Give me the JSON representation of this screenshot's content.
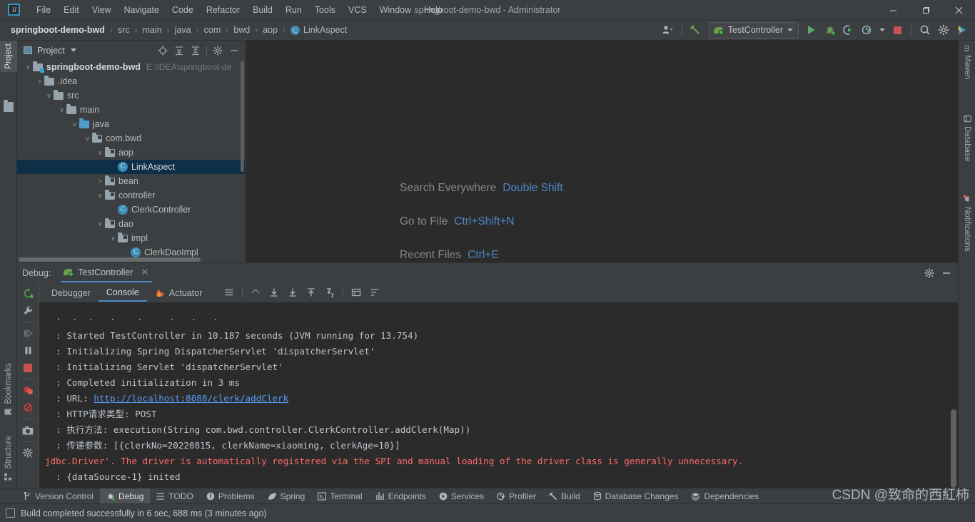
{
  "window": {
    "title": "springboot-demo-bwd - Administrator",
    "minimize": "–",
    "maximize": "❐",
    "close": "✕"
  },
  "menubar": {
    "items": [
      "File",
      "Edit",
      "View",
      "Navigate",
      "Code",
      "Refactor",
      "Build",
      "Run",
      "Tools",
      "VCS",
      "Window",
      "Help"
    ]
  },
  "breadcrumb": {
    "root": "springboot-demo-bwd",
    "separator": "›",
    "items": [
      "src",
      "main",
      "java",
      "com",
      "bwd",
      "aop"
    ],
    "leaf": "LinkAspect",
    "leaf_icon": "C"
  },
  "toolbar": {
    "user_icon": "user-icon",
    "build_icon": "hammer-icon",
    "run_config": "TestController",
    "run_label": "run-button",
    "debug_label": "debug-button",
    "coverage_label": "run-with-coverage-button",
    "profiler_label": "profiler-button",
    "stop_label": "stop-button",
    "search_label": "search-button",
    "settings_label": "settings-button"
  },
  "left_stripe": {
    "project": "Project",
    "bookmarks": "Bookmarks",
    "structure": "Structure"
  },
  "right_stripe": {
    "maven": "Maven",
    "database": "Database",
    "notifications": "Notifications"
  },
  "project_panel": {
    "title": "Project",
    "actions": [
      "locate-icon",
      "expand-all-icon",
      "collapse-all-icon",
      "gear-icon",
      "hide-icon"
    ],
    "tree": [
      {
        "indent": 0,
        "twisty": "v",
        "icon": "module-folder",
        "label": "springboot-demo-bwd",
        "bold": true,
        "path": "E:\\IDEA\\springboot-de",
        "selected": false
      },
      {
        "indent": 1,
        "twisty": ">",
        "icon": "folder",
        "label": ".idea",
        "bold": false,
        "path": "",
        "selected": false
      },
      {
        "indent": 1,
        "twisty": "v",
        "icon": "folder",
        "label": "src",
        "bold": false,
        "path": "",
        "selected": false
      },
      {
        "indent": 2,
        "twisty": "v",
        "icon": "folder",
        "label": "main",
        "bold": false,
        "path": "",
        "selected": false
      },
      {
        "indent": 3,
        "twisty": "v",
        "icon": "source-folder",
        "label": "java",
        "bold": false,
        "path": "",
        "selected": false
      },
      {
        "indent": 4,
        "twisty": "v",
        "icon": "package",
        "label": "com.bwd",
        "bold": false,
        "path": "",
        "selected": false
      },
      {
        "indent": 5,
        "twisty": "v",
        "icon": "package",
        "label": "aop",
        "bold": false,
        "path": "",
        "selected": false
      },
      {
        "indent": 6,
        "twisty": "",
        "icon": "class",
        "label": "LinkAspect",
        "bold": false,
        "path": "",
        "selected": true
      },
      {
        "indent": 5,
        "twisty": ">",
        "icon": "package",
        "label": "bean",
        "bold": false,
        "path": "",
        "selected": false
      },
      {
        "indent": 5,
        "twisty": "v",
        "icon": "package",
        "label": "controller",
        "bold": false,
        "path": "",
        "selected": false
      },
      {
        "indent": 6,
        "twisty": "",
        "icon": "class",
        "label": "ClerkController",
        "bold": false,
        "path": "",
        "selected": false
      },
      {
        "indent": 5,
        "twisty": "v",
        "icon": "package",
        "label": "dao",
        "bold": false,
        "path": "",
        "selected": false
      },
      {
        "indent": 6,
        "twisty": "v",
        "icon": "package",
        "label": "impl",
        "bold": false,
        "path": "",
        "selected": false
      },
      {
        "indent": 7,
        "twisty": "",
        "icon": "class",
        "label": "ClerkDaoImpl",
        "bold": false,
        "path": "",
        "selected": false
      }
    ]
  },
  "editor": {
    "hints": [
      {
        "label": "Search Everywhere",
        "key": "Double Shift"
      },
      {
        "label": "Go to File",
        "key": "Ctrl+Shift+N"
      },
      {
        "label": "Recent Files",
        "key": "Ctrl+E"
      }
    ]
  },
  "debug_panel": {
    "header_label": "Debug:",
    "session_tab": "TestController",
    "close_tab": "✕",
    "header_actions": [
      "gear-icon",
      "hide-icon"
    ],
    "rail_buttons": [
      "rerun-icon",
      "wrench-icon",
      "resume-icon",
      "pause-icon",
      "stop-icon",
      "mute-breakpoints-icon",
      "view-breakpoints-icon",
      "camera-icon",
      "settings-icon",
      "more-icon"
    ],
    "tabs": [
      {
        "label": "Debugger",
        "active": false,
        "icon": ""
      },
      {
        "label": "Console",
        "active": true,
        "icon": ""
      },
      {
        "label": "Actuator",
        "active": false,
        "icon": "actuator-icon"
      }
    ],
    "tab_actions": [
      "layout-icon",
      "soft-wrap-icon",
      "scroll-up-icon",
      "scroll-down-icon",
      "scroll-end-icon",
      "print-icon",
      "table-icon",
      "filter-icon"
    ],
    "console_lines": [
      {
        "text": "  : Started TestController in 10.187 seconds (JVM running for 13.754)",
        "type": "normal"
      },
      {
        "text": "  : Initializing Spring DispatcherServlet 'dispatcherServlet'",
        "type": "normal"
      },
      {
        "text": "  : Initializing Servlet 'dispatcherServlet'",
        "type": "normal"
      },
      {
        "text": "  : Completed initialization in 3 ms",
        "type": "normal"
      },
      {
        "text": "  : URL: ",
        "type": "link",
        "link": "http://localhost:8088/clerk/addClerk"
      },
      {
        "text": "  : HTTP请求类型: POST",
        "type": "normal"
      },
      {
        "text": "  : 执行方法: execution(String com.bwd.controller.ClerkController.addClerk(Map))",
        "type": "normal"
      },
      {
        "text": "  : 传递参数: [{clerkNo=20220815, clerkName=xiaoming, clerkAge=10}]",
        "type": "normal"
      },
      {
        "text": "jdbc.Driver'. The driver is automatically registered via the SPI and manual loading of the driver class is generally unnecessary.",
        "type": "error"
      },
      {
        "text": "  : {dataSource-1} inited",
        "type": "normal"
      }
    ]
  },
  "bottom_bar": {
    "items": [
      {
        "label": "Version Control",
        "icon": "branch-icon",
        "active": false
      },
      {
        "label": "Debug",
        "icon": "bug-icon",
        "active": true
      },
      {
        "label": "TODO",
        "icon": "list-icon",
        "active": false
      },
      {
        "label": "Problems",
        "icon": "warning-icon",
        "active": false
      },
      {
        "label": "Spring",
        "icon": "leaf-icon",
        "active": false
      },
      {
        "label": "Terminal",
        "icon": "terminal-icon",
        "active": false
      },
      {
        "label": "Endpoints",
        "icon": "endpoints-icon",
        "active": false
      },
      {
        "label": "Services",
        "icon": "services-icon",
        "active": false
      },
      {
        "label": "Profiler",
        "icon": "profiler-icon",
        "active": false
      },
      {
        "label": "Build",
        "icon": "hammer-icon",
        "active": false
      },
      {
        "label": "Database Changes",
        "icon": "db-changes-icon",
        "active": false
      },
      {
        "label": "Dependencies",
        "icon": "layers-icon",
        "active": false
      }
    ]
  },
  "status_bar": {
    "message": "Build completed successfully in 6 sec, 688 ms (3 minutes ago)"
  },
  "watermark": {
    "text": "CSDN @致命的西紅柿"
  },
  "colors": {
    "chrome": "#3c3f41",
    "editor_bg": "#2b2b2b",
    "selection": "#0d2f47",
    "accent_blue": "#4a88c7",
    "link": "#589df6",
    "error_red": "#ff6b68",
    "run_green": "#59a869",
    "stop_red": "#c75450"
  }
}
